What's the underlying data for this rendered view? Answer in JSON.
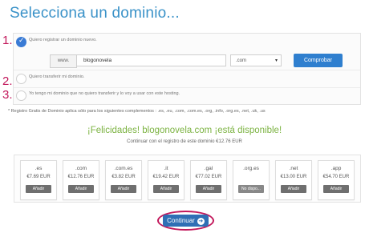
{
  "page": {
    "title": "Selecciona un dominio..."
  },
  "steps": [
    "1.",
    "2.",
    "3."
  ],
  "options": [
    {
      "label": "Quiero registrar un dominio nuevo.",
      "checked": true
    },
    {
      "label": "Quiero transferir mi dominio.",
      "checked": false
    },
    {
      "label": "Yo tengo mi dominio que no quiero transferir y lo voy a usar con este hosting.",
      "checked": false
    }
  ],
  "register": {
    "prefix": "www.",
    "domain_value": "blogonovela",
    "tld_selected": ".com",
    "buy_label": "Comprobar"
  },
  "note": "* Registro Gratis de Dominio aplica sólo para los siguientes complementos : .es, .eu, .com, .com.es, .org, .info, .org.es, .net, .uk, .us",
  "result": {
    "success": "¡Felicidades! blogonovela.com ¡está disponible!",
    "continue_note": "Continuar con el registro de este dominio €12.76 EUR"
  },
  "tld_options": [
    {
      "tld": ".es",
      "price": "€7.69 EUR",
      "action": "Añadir"
    },
    {
      "tld": ".com",
      "price": "€12.76 EUR",
      "action": "Añadir"
    },
    {
      "tld": ".com.es",
      "price": "€3.82 EUR",
      "action": "Añadir"
    },
    {
      "tld": ".it",
      "price": "€19.42 EUR",
      "action": "Añadir"
    },
    {
      "tld": ".gal",
      "price": "€77.02 EUR",
      "action": "Añadir"
    },
    {
      "tld": ".org.es",
      "price": "",
      "action": "No dispo..."
    },
    {
      "tld": ".net",
      "price": "€13.00 EUR",
      "action": "Añadir"
    },
    {
      "tld": ".app",
      "price": "€54.70 EUR",
      "action": "Añadir"
    }
  ],
  "footer": {
    "continue_label": "Continuar"
  },
  "colors": {
    "accent": "#3a92c8",
    "button": "#2f7fcf",
    "success": "#7cb342",
    "annotation": "#c2185b"
  }
}
